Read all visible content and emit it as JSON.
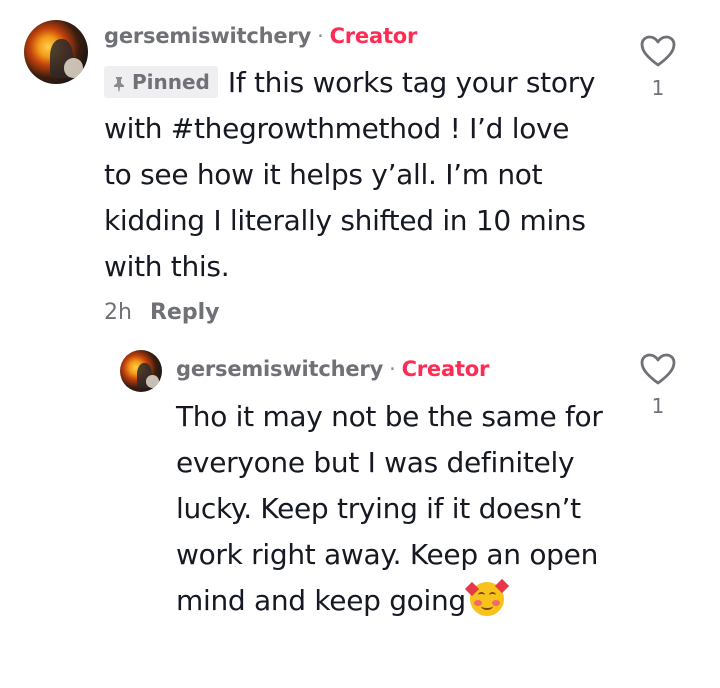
{
  "comments": [
    {
      "username": "gersemiswitchery",
      "separator": "·",
      "badge": "Creator",
      "pinned_label": "Pinned",
      "text": "If this works tag your story with #thegrowthmethod ! I’d love to see how it helps y’all. I’m not kidding I literally shifted in 10 mins with this.",
      "time": "2h",
      "reply_label": "Reply",
      "likes": "1",
      "icons": {
        "like": "heart-outline-icon",
        "pin": "pin-icon"
      }
    }
  ],
  "replies": [
    {
      "username": "gersemiswitchery",
      "separator": "·",
      "badge": "Creator",
      "text": "Tho it may not be the same for everyone but I was definitely lucky. Keep trying if it doesn’t work right away. Keep an open mind and keep going",
      "emoji": "smiling-face-with-hearts",
      "likes": "1",
      "icons": {
        "like": "heart-outline-icon"
      }
    }
  ],
  "colors": {
    "accent": "#fe2c55",
    "meta": "#6f7177",
    "text": "#161823",
    "pinned_bg": "#efeff1"
  }
}
